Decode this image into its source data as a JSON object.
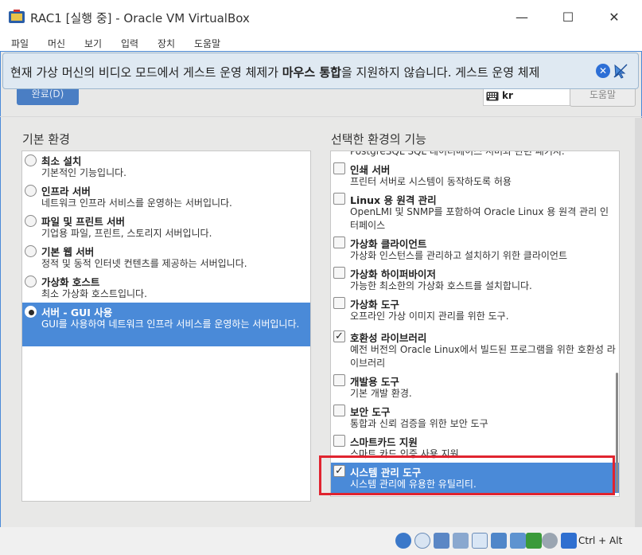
{
  "window": {
    "title": "RAC1 [실행 중] - Oracle VM VirtualBox",
    "minimize_glyph": "—",
    "maximize_glyph": "☐",
    "close_glyph": "✕"
  },
  "menu": [
    "파일",
    "머신",
    "보기",
    "입력",
    "장치",
    "도움말"
  ],
  "notice": {
    "text_before": "현재 가상 머신의 비디오 모드에서 게스트 운영 체제가 ",
    "text_bold": "마우스 통합",
    "text_after": "을 지원하지 않습니다. 게스트 운영 체제",
    "close_glyph": "✕"
  },
  "installer": {
    "done_button": "완료(D)",
    "keyboard_layout": "kr",
    "help_button": "도움말",
    "left_heading": "기본 환경",
    "right_heading": "선택한 환경의 기능",
    "environments": [
      {
        "title": "최소 설치",
        "desc": "기본적인 기능입니다.",
        "selected": false
      },
      {
        "title": "인프라 서버",
        "desc": "네트워크 인프라 서비스를 운영하는 서버입니다.",
        "selected": false
      },
      {
        "title": "파일 및 프린트 서버",
        "desc": "기업용 파일, 프린트, 스토리지 서버입니다.",
        "selected": false
      },
      {
        "title": "기본 웹 서버",
        "desc": "정적 및 동적 인터넷 컨텐츠를 제공하는 서버입니다.",
        "selected": false
      },
      {
        "title": "가상화 호스트",
        "desc": "최소 가상화 호스트입니다.",
        "selected": false
      },
      {
        "title": "서버 - GUI 사용",
        "desc": "GUI를 사용하여 네트워크 인프라 서비스를 운영하는 서버입니다.",
        "selected": true
      }
    ],
    "partial_top_text": "PostgreSQL SQL 데이터베이스 서버와 관련 패키지.",
    "addons": [
      {
        "title": "인쇄 서버",
        "desc": "프린터 서버로 시스템이 동작하도록 허용",
        "checked": false
      },
      {
        "title": "Linux 용 원격 관리",
        "desc": "OpenLMI 및 SNMP를 포함하여 Oracle Linux 용 원격 관리 인터페이스",
        "checked": false
      },
      {
        "title": "가상화 클라이언트",
        "desc": "가상화 인스턴스를 관리하고 설치하기 위한 클라이언트",
        "checked": false
      },
      {
        "title": "가상화 하이퍼바이저",
        "desc": "가능한 최소한의 가상화 호스트를 설치합니다.",
        "checked": false
      },
      {
        "title": "가상화 도구",
        "desc": "오프라인 가상 이미지 관리를 위한 도구.",
        "checked": false
      },
      {
        "title": "호환성 라이브러리",
        "desc": "예전 버전의 Oracle Linux에서 빌드된 프로그램을 위한 호환성 라이브러리",
        "checked": true
      },
      {
        "title": "개발용 도구",
        "desc": "기본 개발 환경.",
        "checked": false
      },
      {
        "title": "보안 도구",
        "desc": "통합과 신뢰 검증을 위한 보안 도구",
        "checked": false
      },
      {
        "title": "스마트카드 지원",
        "desc": "스마트 카드 인증 사용 지원",
        "checked": false
      },
      {
        "title": "시스템 관리 도구",
        "desc": "시스템 관리에 유용한 유틸리티.",
        "checked": true,
        "selected": true
      }
    ]
  },
  "statusbar": {
    "icons": [
      "optical-drive-icon",
      "disk-icon",
      "audio-icon",
      "network-icon",
      "usb-icon",
      "shared-folder-icon",
      "display-icon",
      "recording-icon",
      "cpu-icon",
      "mouse-integration-icon",
      "keyboard-capture-icon"
    ],
    "host_key": "Ctrl + Alt"
  },
  "colors": {
    "selection": "#4a8ad8",
    "highlight_border": "#e0242f",
    "notice_bg": "#dfe9f2"
  }
}
